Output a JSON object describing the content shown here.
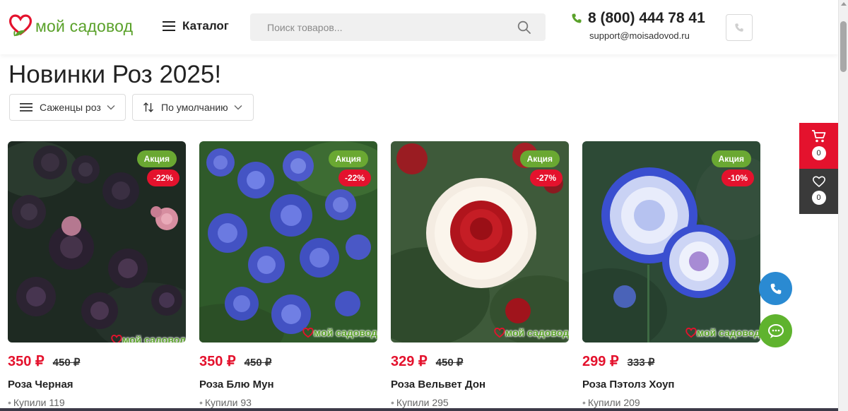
{
  "colors": {
    "brand_green": "#5aa12a",
    "sale_badge": "#6aa832",
    "accent_red": "#e4122d",
    "call_blue": "#2a8ad2",
    "dark_panel": "#3a3a3a"
  },
  "header": {
    "logo_text": "мой садовод",
    "catalog_label": "Каталог",
    "search_placeholder": "Поиск товаров...",
    "phone": "8 (800) 444 78 41",
    "email": "support@moisadovod.ru"
  },
  "page": {
    "title": "Новинки Роз 2025!"
  },
  "filters": {
    "category": "Саженцы роз",
    "sort": "По умолчанию"
  },
  "products": [
    {
      "name": "Роза Черная",
      "price": "350 ₽",
      "old_price": "450 ₽",
      "sale_badge": "Акция",
      "discount": "-22%",
      "sold": "Купили 119",
      "watermark": "мой садовод"
    },
    {
      "name": "Роза Блю Мун",
      "price": "350 ₽",
      "old_price": "450 ₽",
      "sale_badge": "Акция",
      "discount": "-22%",
      "sold": "Купили 93",
      "watermark": "мой садовод"
    },
    {
      "name": "Роза Вельвет Дон",
      "price": "329 ₽",
      "old_price": "450 ₽",
      "sale_badge": "Акция",
      "discount": "-27%",
      "sold": "Купили 295",
      "watermark": "мой садовод"
    },
    {
      "name": "Роза Пэтолз Хоуп",
      "price": "299 ₽",
      "old_price": "333 ₽",
      "sale_badge": "Акция",
      "discount": "-10%",
      "sold": "Купили 209",
      "watermark": "мой садовод"
    }
  ],
  "sidebar": {
    "cart_count": "0",
    "favorites_count": "0"
  },
  "icons": [
    "heart-logo-icon",
    "menu-icon",
    "search-icon",
    "phone-icon",
    "callback-icon",
    "chevron-down-icon",
    "sort-icon",
    "cart-icon",
    "heart-icon",
    "call-icon",
    "chat-icon"
  ]
}
